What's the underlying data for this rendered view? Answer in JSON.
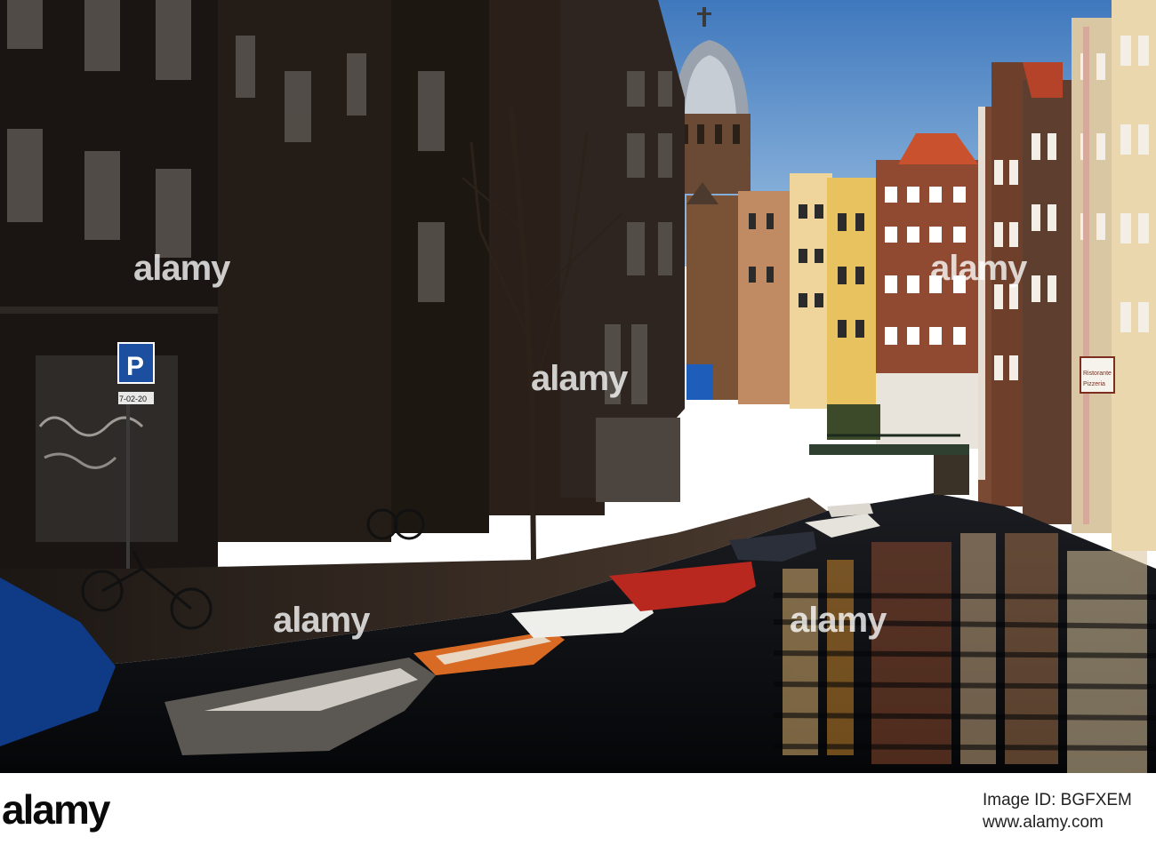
{
  "watermark": {
    "text": "alamy"
  },
  "footer": {
    "logo": "alamy",
    "image_id": "Image ID: BGFXEM",
    "url": "www.alamy.com"
  },
  "signs": {
    "parking": "P",
    "parking_plate": "7-02-20",
    "restaurant_1": "Ristorante",
    "restaurant_2": "Pizzeria"
  },
  "colors": {
    "sky": "#4f86c7",
    "water": "#0b0f14",
    "shadow_buildings": "#15120f",
    "sunlit_facade": "#e9c98a",
    "brick": "#8a4a2e",
    "red_boat": "#b8281e",
    "orange_boat": "#d86a24"
  }
}
